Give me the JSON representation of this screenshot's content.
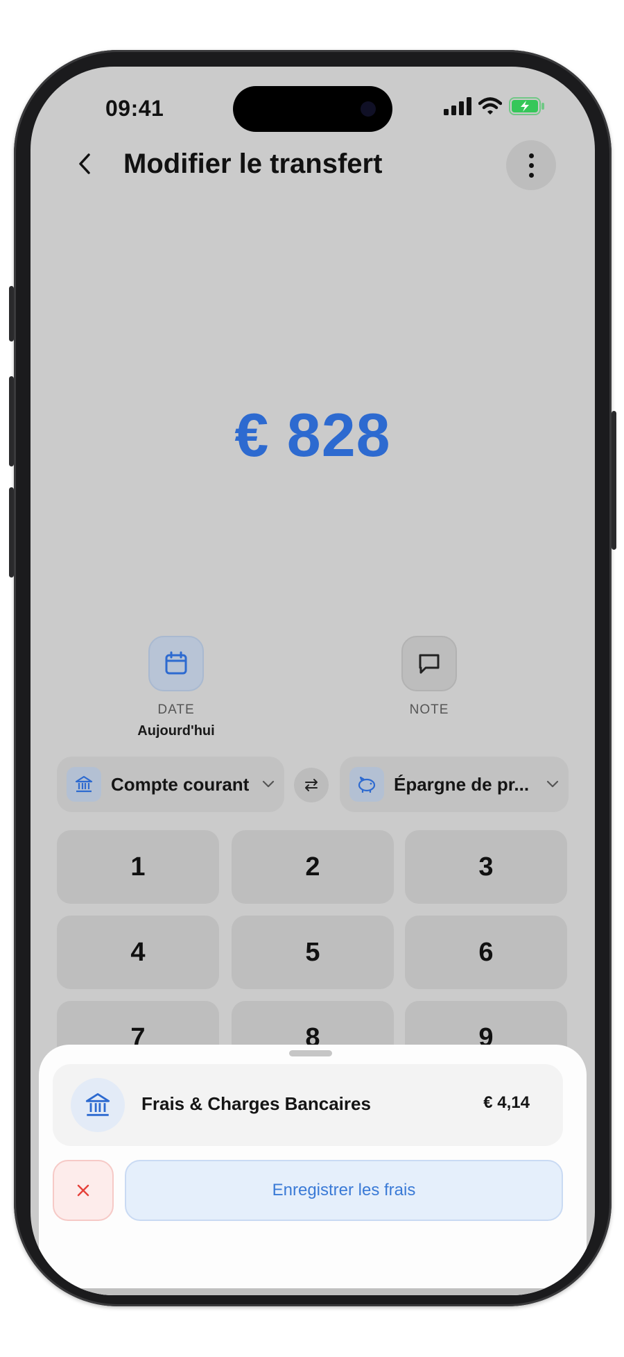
{
  "status": {
    "time": "09:41",
    "battery_color": "#35c759"
  },
  "header": {
    "title": "Modifier le transfert",
    "back_icon": "chevron-left-icon",
    "menu_icon": "more-vertical-icon"
  },
  "amount": {
    "display": "€ 828",
    "color": "#2d6ad0"
  },
  "actions": {
    "date": {
      "label": "DATE",
      "value": "Aujourd'hui",
      "icon": "calendar-icon"
    },
    "note": {
      "label": "NOTE",
      "icon": "message-square-icon"
    }
  },
  "accounts": {
    "from": {
      "name": "Compte courant",
      "icon": "bank-icon"
    },
    "to": {
      "name": "Épargne de pr...",
      "icon": "piggy-bank-icon"
    },
    "swap_icon": "swap-arrows-icon"
  },
  "keypad": {
    "keys": [
      "1",
      "2",
      "3",
      "4",
      "5",
      "6",
      "7",
      "8",
      "9"
    ]
  },
  "fee_sheet": {
    "category": "Frais & Charges Bancaires",
    "amount": "€ 4,14",
    "icon": "bank-icon",
    "cancel_icon": "close-icon",
    "save_label": "Enregistrer les frais"
  }
}
